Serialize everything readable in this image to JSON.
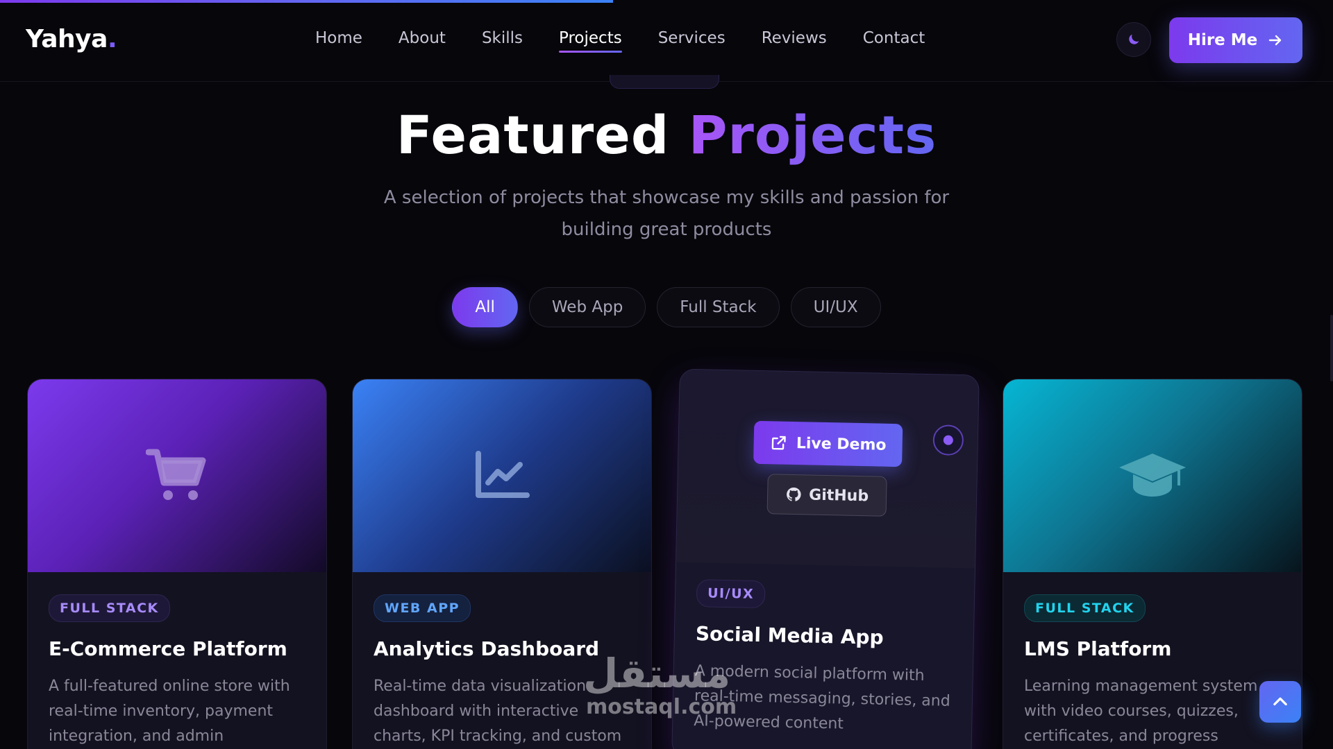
{
  "nav": {
    "logo_text": "Yahya",
    "logo_dot": ".",
    "links": [
      "Home",
      "About",
      "Skills",
      "Projects",
      "Services",
      "Reviews",
      "Contact"
    ],
    "active_link": "Projects",
    "hire_label": "Hire Me",
    "scroll_progress": 0.46
  },
  "section": {
    "title_plain": "Featured",
    "title_accent": "Projects",
    "subtitle": "A selection of projects that showcase my skills and passion for building great products"
  },
  "filters": [
    "All",
    "Web App",
    "Full Stack",
    "UI/UX"
  ],
  "active_filter": "All",
  "projects": [
    {
      "tag": "FULL STACK",
      "title": "E-Commerce Platform",
      "description": "A full-featured online store with real-time inventory, payment integration, and admin",
      "icon": "shopping-cart-icon",
      "accent": "#7c3aed"
    },
    {
      "tag": "WEB APP",
      "title": "Analytics Dashboard",
      "description": "Real-time data visualization dashboard with interactive charts, KPI tracking, and custom",
      "icon": "line-chart-icon",
      "accent": "#3b82f6"
    },
    {
      "tag": "UI/UX",
      "title": "Social Media App",
      "description": "A modern social platform with real-time messaging, stories, and AI-powered content",
      "icon": "none",
      "accent": "#8b5cf6",
      "live_demo_label": "Live Demo",
      "github_label": "GitHub"
    },
    {
      "tag": "FULL STACK",
      "title": "LMS Platform",
      "description": "Learning management system with video courses, quizzes, certificates, and progress",
      "icon": "graduation-cap-icon",
      "accent": "#06b6d4"
    }
  ],
  "watermark": {
    "arabic": "مستقل",
    "latin": "mostaql.com"
  }
}
